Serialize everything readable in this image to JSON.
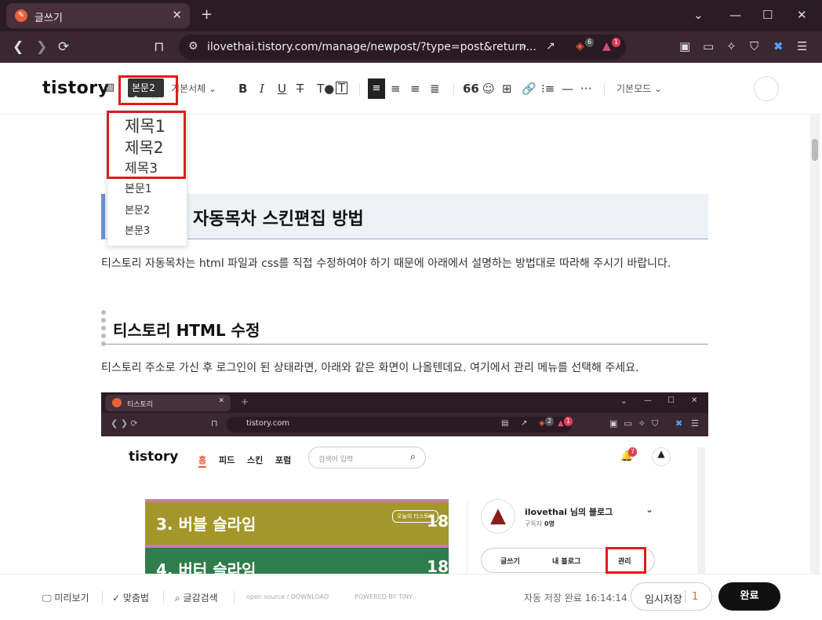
{
  "browser": {
    "tab_title": "글쓰기",
    "url": "ilovethai.tistory.com/manage/newpost/?type=post&return...",
    "brave_badge": "6",
    "alert_badge": "1"
  },
  "editor": {
    "logo": "tistory",
    "heading_select": "본문2",
    "font_select": "기본서체",
    "mode_select": "기본모드",
    "dropdown_options": [
      "제목1",
      "제목2",
      "제목3",
      "본문1",
      "본문2",
      "본문3"
    ]
  },
  "content": {
    "h2": "자동목차 스킨편집 방법",
    "para1": "티스토리 자동목차는 html 파일과 css를 직접 수정하여야 하기 때문에 아래에서 설명하는 방법대로 따라해 주시기 바랍니다.",
    "h3": "티스토리 HTML 수정",
    "para2": "티스토리 주소로 가신 후 로그인이 된 상태라면, 아래와 같은 화면이 나올텐데요. 여기에서 관리 메뉴를 선택해 주세요."
  },
  "embedded": {
    "tab_title": "티스토리",
    "url": "tistory.com",
    "logo": "tistory",
    "nav": [
      "홈",
      "피드",
      "스킨",
      "포럼"
    ],
    "search_placeholder": "검색어 입력",
    "banner1": "3. 버블 슬라임",
    "banner1_num": "18",
    "banner1_tag": "오늘의 티스토리",
    "banner2": "4. 버터 슬라임",
    "banner2_num": "18",
    "blog_name": "ilovethai 님의 블로그",
    "subscribers_label": "구독자",
    "subscribers": "0명",
    "btn_write": "글쓰기",
    "btn_myblog": "내 블로그",
    "btn_manage": "관리",
    "notif_badge": "7",
    "brave_badge": "2",
    "alert_badge": "1"
  },
  "footer": {
    "preview": "미리보기",
    "spellcheck": "맞춤법",
    "search": "글감검색",
    "opensource": "open source / DOWNLOAD",
    "powered": "POWERED BY TINY",
    "autosave": "자동 저장 완료 16:14:14",
    "draft_label": "임시저장",
    "draft_count": "1",
    "done": "완료"
  },
  "colors": {
    "highlight_box": "#e21a1a",
    "h2_accent": "#6a8fd8",
    "chrome_dark": "#2b1c24"
  }
}
